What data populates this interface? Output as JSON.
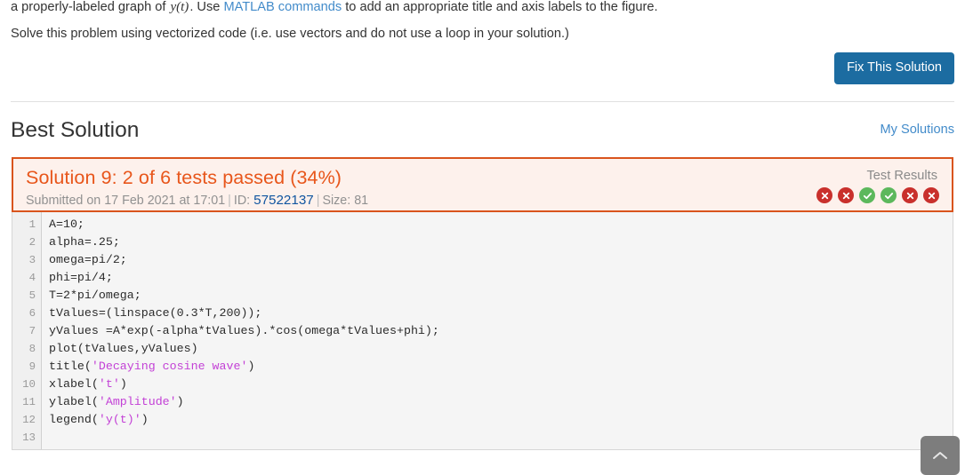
{
  "problem": {
    "line1_before": "a properly-labeled graph of ",
    "line1_math": "y(t)",
    "line1_middle": ".  Use ",
    "line1_link": "MATLAB commands",
    "line1_after": " to add an appropriate title and axis labels to the figure.",
    "line2": "Solve this problem using vectorized code (i.e. use vectors and do not use a loop in your solution.)"
  },
  "actions": {
    "fix_solution_label": "Fix This Solution",
    "fix_solution_color": "#1c6ca1"
  },
  "section": {
    "title": "Best Solution",
    "my_solutions_label": "My Solutions"
  },
  "solution": {
    "heading": "Solution 9: 2 of 6 tests passed (34%)",
    "heading_color": "#e8561b",
    "border_color": "#d9541d",
    "background_color": "#fdf1ec",
    "submitted_label": "Submitted on 17 Feb 2021 at 17:01",
    "separator": "|",
    "id_label": "ID:",
    "id_value": "57522137",
    "size_label": "Size:",
    "size_value": "81",
    "test_results_label": "Test Results",
    "test_results": [
      {
        "status": "fail",
        "icon": "cross-circle-icon"
      },
      {
        "status": "fail",
        "icon": "cross-circle-icon"
      },
      {
        "status": "pass",
        "icon": "check-circle-icon"
      },
      {
        "status": "pass",
        "icon": "check-circle-icon"
      },
      {
        "status": "fail",
        "icon": "cross-circle-icon"
      },
      {
        "status": "fail",
        "icon": "cross-circle-icon"
      }
    ],
    "pass_color": "#5cb85c",
    "fail_color": "#c9302c"
  },
  "code": {
    "line_numbers": [
      "1",
      "2",
      "3",
      "4",
      "5",
      "6",
      "7",
      "8",
      "9",
      "10",
      "11",
      "12",
      "13"
    ],
    "lines": [
      [
        {
          "t": "A=10;",
          "c": "plain"
        }
      ],
      [
        {
          "t": "alpha=.25;",
          "c": "plain"
        }
      ],
      [
        {
          "t": "omega=pi/2;",
          "c": "plain"
        }
      ],
      [
        {
          "t": "phi=pi/4;",
          "c": "plain"
        }
      ],
      [
        {
          "t": "T=2*pi/omega;",
          "c": "plain"
        }
      ],
      [
        {
          "t": "tValues=(linspace(0.3*T,200));",
          "c": "plain"
        }
      ],
      [
        {
          "t": "yValues =A*exp(-alpha*tValues).*cos(omega*tValues+phi);",
          "c": "plain"
        }
      ],
      [
        {
          "t": "plot(tValues,yValues)",
          "c": "plain"
        }
      ],
      [
        {
          "t": "title(",
          "c": "plain"
        },
        {
          "t": "'Decaying cosine wave'",
          "c": "str"
        },
        {
          "t": ")",
          "c": "plain"
        }
      ],
      [
        {
          "t": "xlabel(",
          "c": "plain"
        },
        {
          "t": "'t'",
          "c": "str"
        },
        {
          "t": ")",
          "c": "plain"
        }
      ],
      [
        {
          "t": "ylabel(",
          "c": "plain"
        },
        {
          "t": "'Amplitude'",
          "c": "str"
        },
        {
          "t": ")",
          "c": "plain"
        }
      ],
      [
        {
          "t": "legend(",
          "c": "plain"
        },
        {
          "t": "'y(t)'",
          "c": "str"
        },
        {
          "t": ")",
          "c": "plain"
        }
      ],
      [
        {
          "t": "",
          "c": "plain"
        }
      ]
    ],
    "string_color": "#c341d6"
  },
  "scroll_top": {
    "icon": "chevron-up-icon",
    "color": "#7d7d7d"
  }
}
